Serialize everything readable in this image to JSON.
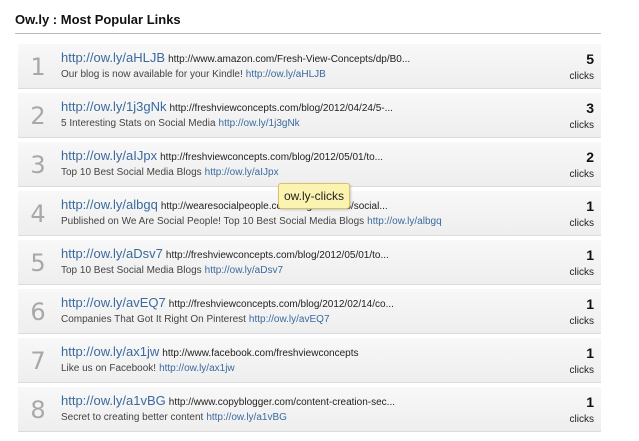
{
  "panel": {
    "title": "Ow.ly : Most Popular Links"
  },
  "tooltip": {
    "text": "ow.ly-clicks"
  },
  "rows": [
    {
      "rank": "1",
      "short_url": "http://ow.ly/aHLJB",
      "long_url": "http://www.amazon.com/Fresh-View-Concepts/dp/B0...",
      "message": "Our blog is now available for your Kindle!",
      "message_link": "http://ow.ly/aHLJB",
      "clicks": "5",
      "clicks_label": "clicks"
    },
    {
      "rank": "2",
      "short_url": "http://ow.ly/1j3gNk",
      "long_url": "http://freshviewconcepts.com/blog/2012/04/24/5-...",
      "message": "5 Interesting Stats on Social Media",
      "message_link": "http://ow.ly/1j3gNk",
      "clicks": "3",
      "clicks_label": "clicks"
    },
    {
      "rank": "3",
      "short_url": "http://ow.ly/aIJpx",
      "long_url": "http://freshviewconcepts.com/blog/2012/05/01/to...",
      "message": "Top 10 Best Social Media Blogs",
      "message_link": "http://ow.ly/aIJpx",
      "clicks": "2",
      "clicks_label": "clicks"
    },
    {
      "rank": "4",
      "short_url": "http://ow.ly/albgq",
      "long_url": "http://wearesocialpeople.com/blog/2012/05/social...",
      "message": "Published on We Are Social People! Top 10 Best Social Media Blogs",
      "message_link": "http://ow.ly/albgq",
      "clicks": "1",
      "clicks_label": "clicks"
    },
    {
      "rank": "5",
      "short_url": "http://ow.ly/aDsv7",
      "long_url": "http://freshviewconcepts.com/blog/2012/05/01/to...",
      "message": "Top 10 Best Social Media Blogs",
      "message_link": "http://ow.ly/aDsv7",
      "clicks": "1",
      "clicks_label": "clicks"
    },
    {
      "rank": "6",
      "short_url": "http://ow.ly/avEQ7",
      "long_url": "http://freshviewconcepts.com/blog/2012/02/14/co...",
      "message": "Companies That Got It Right On Pinterest",
      "message_link": "http://ow.ly/avEQ7",
      "clicks": "1",
      "clicks_label": "clicks"
    },
    {
      "rank": "7",
      "short_url": "http://ow.ly/ax1jw",
      "long_url": "http://www.facebook.com/freshviewconcepts",
      "message": "Like us on Facebook!",
      "message_link": "http://ow.ly/ax1jw",
      "clicks": "1",
      "clicks_label": "clicks"
    },
    {
      "rank": "8",
      "short_url": "http://ow.ly/a1vBG",
      "long_url": "http://www.copyblogger.com/content-creation-sec...",
      "message": "Secret to creating better content",
      "message_link": "http://ow.ly/a1vBG",
      "clicks": "1",
      "clicks_label": "clicks"
    }
  ]
}
